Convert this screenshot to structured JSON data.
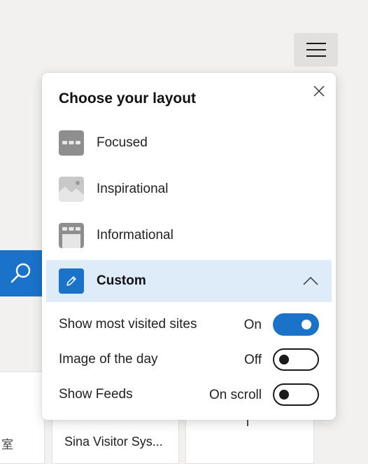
{
  "background": {
    "bottom_left_char": "室",
    "card_text": "Sina Visitor Sys...",
    "card_text_2": "l",
    "menu_icon": "hamburger-icon",
    "search_icon": "search-icon"
  },
  "panel": {
    "title": "Choose your layout",
    "close_icon": "close-icon",
    "options": [
      {
        "label": "Focused",
        "icon": "focused-layout-icon"
      },
      {
        "label": "Inspirational",
        "icon": "inspirational-layout-icon"
      },
      {
        "label": "Informational",
        "icon": "informational-layout-icon"
      },
      {
        "label": "Custom",
        "icon": "pencil-icon",
        "selected": true,
        "expanded": true
      }
    ],
    "settings": [
      {
        "label": "Show most visited sites",
        "state": "On",
        "enabled": true
      },
      {
        "label": "Image of the day",
        "state": "Off",
        "enabled": false
      },
      {
        "label": "Show Feeds",
        "state": "On scroll",
        "enabled": false
      }
    ]
  },
  "colors": {
    "accent": "#1a73c9",
    "selected_bg": "#deecf9",
    "page_bg": "#f2f1ef",
    "icon_gray": "#8e8e8e"
  }
}
